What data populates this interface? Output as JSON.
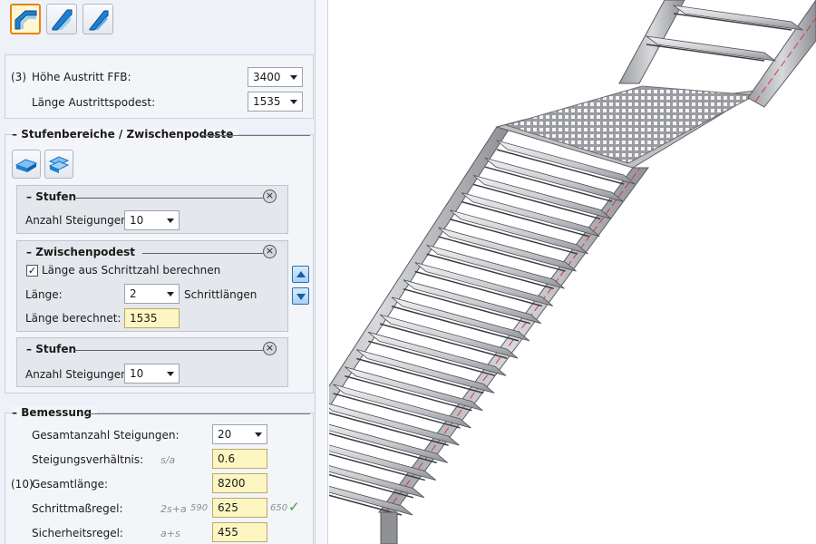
{
  "toolbar": {
    "icons": [
      "stair-straight-icon",
      "stair-stringer-icon",
      "stair-stringer-alt-icon"
    ]
  },
  "exit": {
    "height_index": "(3)",
    "height_label": "Höhe Austritt FFB:",
    "height_value": "3400",
    "landing_length_label": "Länge Austrittspodest:",
    "landing_length_value": "1535"
  },
  "ranges": {
    "title": "Stufenbereiche / Zwischenpodeste",
    "stufen1": {
      "title": "Stufen",
      "count_label": "Anzahl Steigungen:",
      "count_value": "10"
    },
    "podest": {
      "title": "Zwischenpodest",
      "checkbox_label": "Länge aus Schrittzahl berechnen",
      "checkbox_checked": true,
      "length_label": "Länge:",
      "length_value": "2",
      "length_unit": "Schrittlängen",
      "computed_label": "Länge berechnet:",
      "computed_value": "1535"
    },
    "stufen2": {
      "title": "Stufen",
      "count_label": "Anzahl Steigungen:",
      "count_value": "10"
    }
  },
  "bemessung": {
    "title": "Bemessung",
    "total_steps_label": "Gesamtanzahl Steigungen:",
    "total_steps_value": "20",
    "ratio_label": "Steigungsverhältnis:",
    "ratio_formula": "s/a",
    "ratio_value": "0.6",
    "length_index": "(10)",
    "length_label": "Gesamtlänge:",
    "length_value": "8200",
    "step_rule_label": "Schrittmaßregel:",
    "step_rule_formula": "2s+a",
    "step_rule_min": "590",
    "step_rule_value": "625",
    "step_rule_max": "650",
    "safety_label": "Sicherheitsregel:",
    "safety_formula": "a+s",
    "safety_value": "455"
  },
  "colors": {
    "accent_orange": "#e0851a",
    "field_yellow": "#fdf6c2",
    "ok_green": "#3aa03a",
    "icon_blue": "#1f7fd1"
  }
}
